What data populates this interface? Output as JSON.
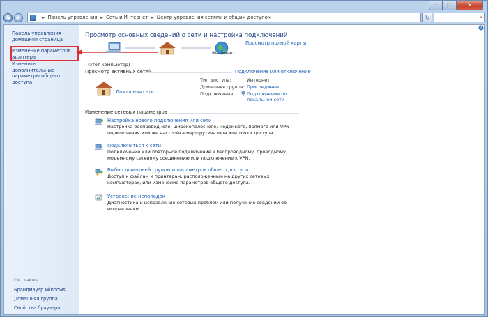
{
  "window": {
    "caption": {
      "minimize": "─",
      "maximize": "□",
      "close": "✕"
    }
  },
  "nav": {
    "back": "◄",
    "forward": "►",
    "breadcrumbs": [
      "Панель управления",
      "Сеть и Интернет",
      "Центр управления сетями и общим доступом"
    ],
    "separator": "►",
    "refresh": "↻",
    "search_icon": "⌕"
  },
  "sidebar": {
    "home": "Панель управления - домашняя страница",
    "adapter": "Изменение параметров адаптера",
    "sharing": "Изменить дополнительные параметры общего доступа",
    "see_also": "См. также",
    "links": [
      "Брандмауэр Windows",
      "Домашняя группа",
      "Свойства браузера"
    ]
  },
  "main": {
    "title": "Просмотр основных сведений о сети и настройка подключений",
    "full_map": "Просмотр полной карты",
    "map": {
      "computer": "(этот компьютер)",
      "internet": "Интернет"
    },
    "active": {
      "heading": "Просмотр активных сетей",
      "connect_link": "Подключение или отключение",
      "network_name": "Домашняя сеть",
      "access_type_label": "Тип доступа:",
      "access_type_value": "Интернет",
      "homegroup_label": "Домашняя группа:",
      "homegroup_value": "Присоединен",
      "connections_label": "Подключения:",
      "connection_value_1": "Подключение по",
      "connection_value_2": "локальной сети"
    },
    "change": {
      "heading": "Изменение сетевых параметров",
      "tasks": [
        {
          "link": "Настройка нового подключения или сети",
          "desc": "Настройка беспроводного, широкополосного, модемного, прямого или VPN-подключения или же настройка маршрутизатора или точки доступа."
        },
        {
          "link": "Подключиться к сети",
          "desc": "Подключение или повторное подключение к беспроводному, проводному, модемному сетевому соединению или подключение к VPN."
        },
        {
          "link": "Выбор домашней группы и параметров общего доступа",
          "desc": "Доступ к файлам и принтерам, расположенным на других сетевых компьютерах, или изменение параметров общего доступа."
        },
        {
          "link": "Устранение неполадок",
          "desc": "Диагностика и исправление сетевых проблем или получение сведений об исправлении."
        }
      ]
    }
  },
  "colors": {
    "accent": "#1b5fb3",
    "highlight": "#e0313b"
  }
}
